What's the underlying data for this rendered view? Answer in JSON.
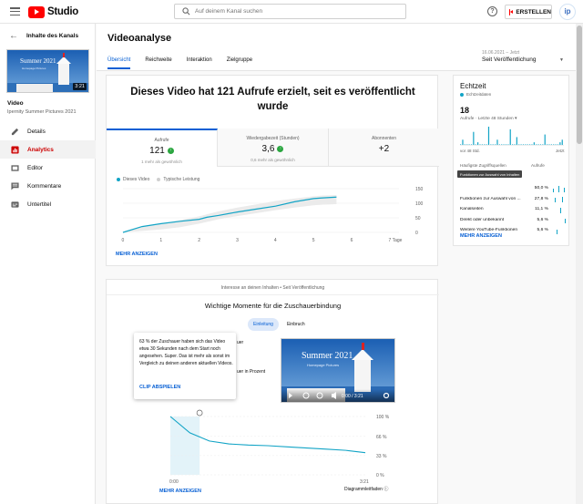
{
  "topbar": {
    "logo_text": "Studio",
    "search_placeholder": "Auf deinem Kanal suchen",
    "create_label": "ERSTELLEN",
    "avatar_initials": "ip"
  },
  "sidebar": {
    "back_label": "Inhalte des Kanals",
    "thumb_title": "Summer 2021",
    "thumb_subtitle": "Homepage Pictures",
    "thumb_duration": "3:21",
    "video_label": "Video",
    "video_title": "Ipernity Summer Pictures 2021",
    "items": [
      {
        "label": "Details",
        "icon": "pencil-icon"
      },
      {
        "label": "Analytics",
        "icon": "analytics-icon",
        "active": true
      },
      {
        "label": "Editor",
        "icon": "film-icon"
      },
      {
        "label": "Kommentare",
        "icon": "comment-icon"
      },
      {
        "label": "Untertitel",
        "icon": "subtitles-icon"
      }
    ]
  },
  "header": {
    "title": "Videoanalyse",
    "tabs": [
      "Übersicht",
      "Reichweite",
      "Interaktion",
      "Zielgruppe"
    ],
    "range_small": "16.06.2021 – Jetzt",
    "range_selected": "Seit Veröffentlichung"
  },
  "overview": {
    "headline": "Dieses Video hat 121 Aufrufe erzielt, seit es veröffentlicht wurde",
    "metrics": [
      {
        "label": "Aufrufe",
        "value": "121",
        "sub": "1 mehr als gewöhnlich"
      },
      {
        "label": "Wiedergabezeit (Stunden)",
        "value": "3,6",
        "sub": "0,6 mehr als gewöhnlich"
      },
      {
        "label": "Abonnenten",
        "value": "+2",
        "sub": ""
      }
    ],
    "legend_this": "Dieses Video",
    "legend_typical": "Typische Leistung",
    "more": "MEHR ANZEIGEN",
    "x_suffix": "Tage",
    "colors": {
      "series": "#12a4c6",
      "band": "#ebebeb",
      "accent": "#065fd4"
    }
  },
  "chart_data": [
    {
      "type": "line",
      "title": "",
      "x": [
        0,
        0.5,
        1,
        1.5,
        2,
        2.2,
        2.5,
        3,
        3.5,
        4,
        4.5,
        5,
        5.2,
        5.6
      ],
      "series": [
        {
          "name": "Dieses Video",
          "values": [
            0,
            20,
            30,
            38,
            45,
            52,
            58,
            70,
            80,
            90,
            105,
            116,
            118,
            121
          ]
        }
      ],
      "band_low": [
        0,
        5,
        10,
        18,
        30,
        36,
        45,
        56,
        66,
        76,
        85,
        93,
        95,
        97
      ],
      "band_high": [
        0,
        18,
        30,
        42,
        55,
        62,
        72,
        85,
        96,
        108,
        116,
        124,
        126,
        128
      ],
      "x_ticks": [
        "0",
        "1",
        "2",
        "3",
        "4",
        "5",
        "6",
        "7 Tage"
      ],
      "y_ticks": [
        "0",
        "50",
        "100",
        "150"
      ],
      "xlim": [
        0,
        7
      ],
      "ylim": [
        0,
        150
      ]
    },
    {
      "type": "bar",
      "title": "",
      "values": [
        0,
        2,
        0,
        0,
        0,
        0,
        5,
        0,
        1,
        0,
        0,
        0,
        0,
        7,
        0,
        0,
        0,
        2,
        0,
        0,
        0,
        0,
        0,
        6,
        0,
        0,
        3,
        0,
        0,
        0,
        0,
        0,
        0,
        0,
        1,
        0,
        0,
        0,
        0,
        4,
        0,
        0,
        0,
        0,
        0,
        0,
        1,
        2
      ],
      "axis_left": "vor 48 Std.",
      "axis_right": "Jetzt"
    },
    {
      "type": "line",
      "title": "",
      "x": [
        0,
        0.1,
        0.2,
        0.3,
        0.4,
        0.5,
        0.6,
        0.7,
        0.8,
        0.9,
        1.0
      ],
      "series": [
        {
          "name": "",
          "values": [
            100,
            72,
            58,
            53,
            51,
            50,
            48,
            46,
            44,
            42,
            38
          ]
        }
      ],
      "x_ticks": [
        "0:00",
        "3:21"
      ],
      "y_ticks": [
        "0 %",
        "33 %",
        "66 %",
        "100 %"
      ],
      "highlight_x": [
        0,
        0.15
      ],
      "ylim": [
        0,
        100
      ]
    }
  ],
  "realtime": {
    "title": "Echtzeit",
    "live": "Echtzeitdaten",
    "count": "18",
    "sub": "Aufrufe · Letzte 48 Stunden",
    "axis_left": "vor 48 Std.",
    "axis_right": "Jetzt",
    "sources_head": "Häufigste Zugriffsquellen",
    "sources_col": "Aufrufe",
    "tooltip": "Funktionen zur Auswahl von Inhalten",
    "sources": [
      {
        "name": "Funktionen zur Auswahl von Inhalten",
        "pct": "50,0 %",
        "short": "YouTube-Suche"
      },
      {
        "name": "Funktionen zur Auswahl von ...",
        "pct": "27,8 %"
      },
      {
        "name": "Kanalseiten",
        "pct": "11,1 %"
      },
      {
        "name": "Direkt oder unbekannt",
        "pct": "5,6 %"
      },
      {
        "name": "Weitere YouTube-Funktionen",
        "pct": "5,6 %"
      }
    ],
    "more": "MEHR ANZEIGEN"
  },
  "retention": {
    "note": "Interesse an deinen Inhalten • Seit Veröffentlichung",
    "title": "Wichtige Momente für die Zuschauerbindung",
    "pills": [
      "Einleitung",
      "Einbruch"
    ],
    "fragment_1": "uer",
    "fragment_2": "uer in Prozent",
    "popup_text": "63 % der Zuschauer haben sich das Video etwa 30 Sekunden nach dem Start noch angesehen. Super. Das ist mehr als sonst im Vergleich zu deinen anderen aktuellen Videos.",
    "popup_link": "CLIP ABSPIELEN",
    "player_time": "0:00 / 3:21",
    "player_title": "Summer 2021",
    "player_subtitle": "Homepage Pictures",
    "diagram_label": "Diagrammleitfaden",
    "more": "MEHR ANZEIGEN"
  }
}
